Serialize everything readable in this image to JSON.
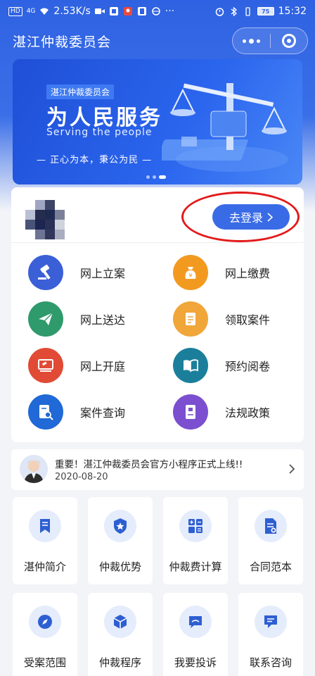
{
  "status_bar": {
    "hd": "HD",
    "signal": "4G",
    "speed": "2.53K/s",
    "battery": "75",
    "time": "15:32"
  },
  "nav": {
    "title": "湛江仲裁委员会"
  },
  "banner": {
    "tag": "湛江仲裁委员会",
    "title": "为人民服务",
    "subtitle": "Serving the people",
    "slogan": "— 正心为本，秉公为民 —"
  },
  "login": {
    "button_label": "去登录"
  },
  "services": [
    {
      "label": "网上立案",
      "icon": "gavel-icon",
      "color": "#3b5fd6"
    },
    {
      "label": "网上缴费",
      "icon": "money-bag-icon",
      "color": "#f29a1f"
    },
    {
      "label": "网上送达",
      "icon": "paper-plane-icon",
      "color": "#2f9a6b"
    },
    {
      "label": "领取案件",
      "icon": "document-icon",
      "color": "#f1a63a"
    },
    {
      "label": "网上开庭",
      "icon": "court-screen-icon",
      "color": "#e14b36"
    },
    {
      "label": "预约阅卷",
      "icon": "open-book-icon",
      "color": "#1b7f9c"
    },
    {
      "label": "案件查询",
      "icon": "doc-search-icon",
      "color": "#2069d6"
    },
    {
      "label": "法规政策",
      "icon": "law-book-icon",
      "color": "#7b4fd0"
    }
  ],
  "notice": {
    "text": "重要！湛江仲裁委员会官方小程序正式上线!!",
    "date": "2020-08-20"
  },
  "grid": [
    {
      "label": "湛仲简介",
      "icon": "bookmark-icon"
    },
    {
      "label": "仲裁优势",
      "icon": "shield-star-icon"
    },
    {
      "label": "仲裁费计算",
      "icon": "calculator-icon"
    },
    {
      "label": "合同范本",
      "icon": "contract-icon"
    },
    {
      "label": "受案范围",
      "icon": "compass-icon"
    },
    {
      "label": "仲裁程序",
      "icon": "cube-icon"
    },
    {
      "label": "我要投诉",
      "icon": "chat-bubble-icon"
    },
    {
      "label": "联系咨询",
      "icon": "message-icon"
    }
  ]
}
